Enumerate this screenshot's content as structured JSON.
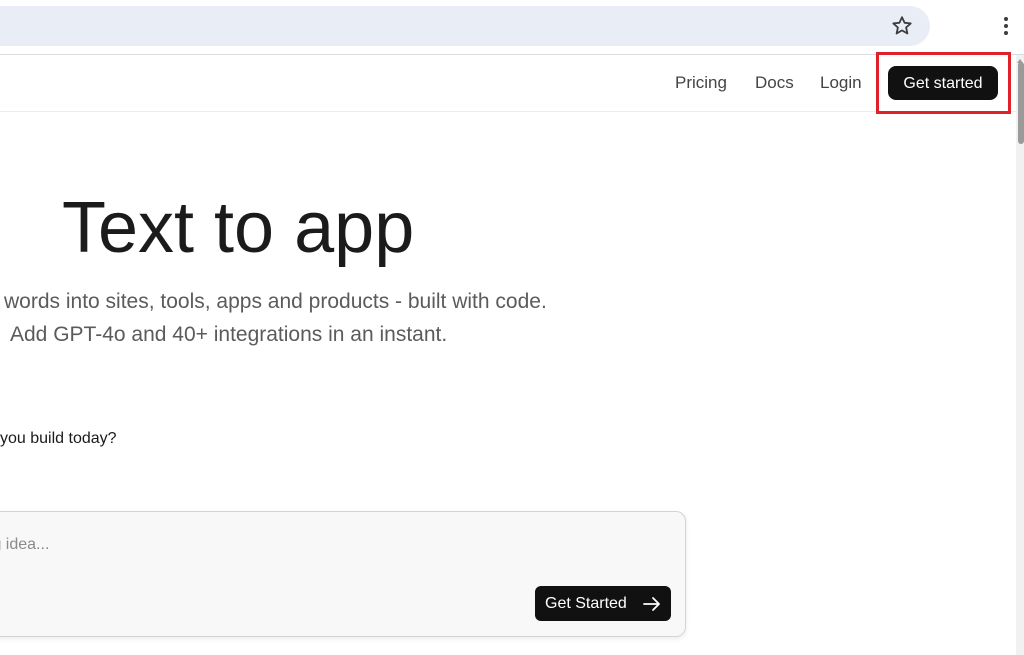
{
  "browser": {
    "icons": [
      "star-icon",
      "more-vert-icon"
    ]
  },
  "nav": {
    "pricing": "Pricing",
    "docs": "Docs",
    "login": "Login",
    "cta": "Get started"
  },
  "hero": {
    "title": "Text to app",
    "subtitle_line1": "words into sites, tools, apps and products - built with code.",
    "subtitle_line2": "Add GPT-4o and 40+ integrations in an instant."
  },
  "prompt": {
    "label": "you build today?",
    "placeholder": "big idea...",
    "submit": "Get Started",
    "submit_icon": "arrow-right-icon"
  },
  "colors": {
    "highlight": "#e0202a",
    "button_bg": "#111111",
    "url_bar": "#e9eef6"
  }
}
